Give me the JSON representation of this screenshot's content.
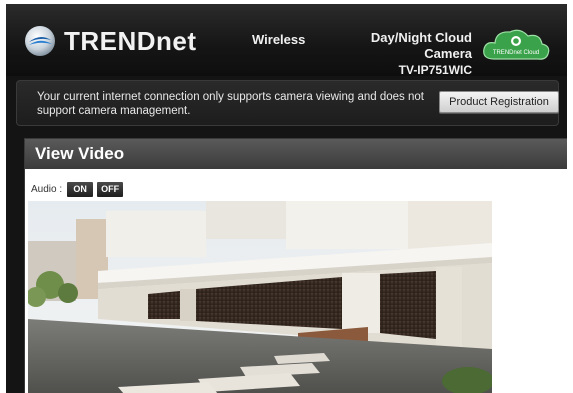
{
  "header": {
    "brand": "TRENDnet",
    "product_type": "Wireless",
    "product_name": "Day/Night Cloud Camera",
    "model": "TV-IP751WIC",
    "cloud_badge": "TRENDnet Cloud"
  },
  "notice": {
    "message": "Your current internet connection only supports camera viewing and does not support camera management.",
    "button_label": "Product Registration"
  },
  "panel": {
    "title": "View Video",
    "audio_label": "Audio :",
    "audio_on": "ON",
    "audio_off": "OFF"
  },
  "colors": {
    "header_bg": "#141414",
    "panel_title_bg": "#4a4a4a",
    "cloud_green": "#3aa24a"
  },
  "icons": [
    "trendnet-logo-icon",
    "cloud-badge-icon"
  ]
}
